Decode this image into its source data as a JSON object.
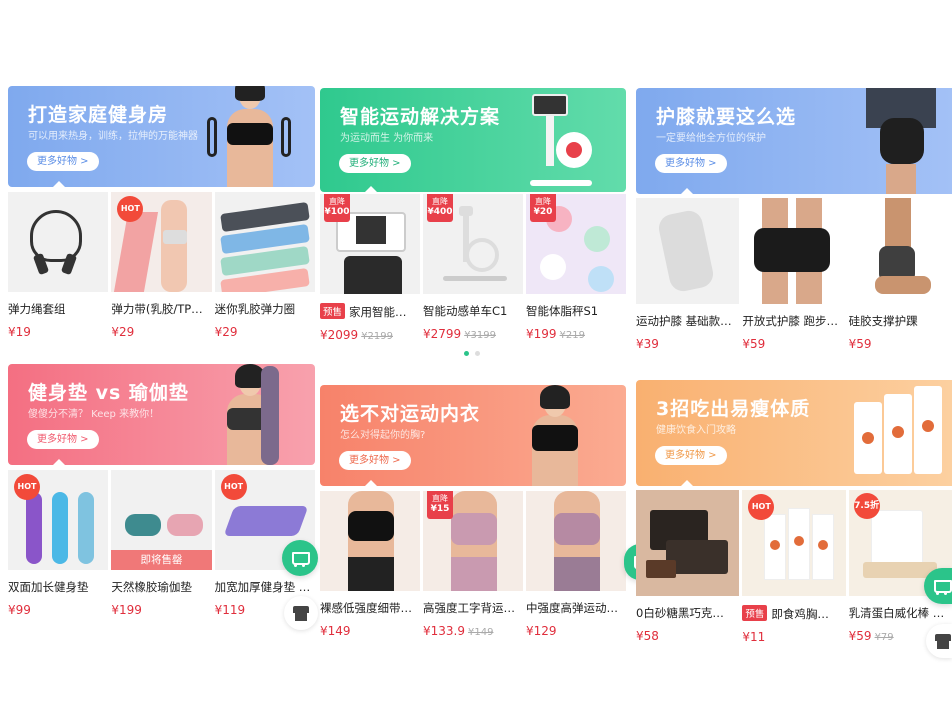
{
  "panels": [
    {
      "id": "home-gym",
      "banner": {
        "title": "打造家庭健身房",
        "subtitle": "可以用来热身，训练，拉伸的万能神器",
        "more": "更多好物 >",
        "bg1": "#7fa9ee",
        "bg2": "#9dbdf5",
        "more_color": "#5b8ee6"
      },
      "products": [
        {
          "name": "弹力绳套组",
          "price": "¥19",
          "badge": ""
        },
        {
          "name": "弹力带(乳胶/TP…",
          "price": "¥29",
          "badge": "HOT"
        },
        {
          "name": "迷你乳胶弹力圈",
          "price": "¥29",
          "badge": ""
        }
      ]
    },
    {
      "id": "smart-sport",
      "banner": {
        "title": "智能运动解决方案",
        "subtitle": "为运动而生 为你而来",
        "more": "更多好物 >",
        "bg1": "#2fc98e",
        "bg2": "#5ad9a7",
        "more_color": "#22b07a"
      },
      "products": [
        {
          "name": "家用智能…",
          "price": "¥2099",
          "orig": "¥2199",
          "pretag": "预售",
          "zhijiang": "¥100"
        },
        {
          "name": "智能动感单车C1",
          "price": "¥2799",
          "orig": "¥3199",
          "zhijiang": "¥400"
        },
        {
          "name": "智能体脂秤S1",
          "price": "¥199",
          "orig": "¥219",
          "zhijiang": "¥20"
        }
      ]
    },
    {
      "id": "knee",
      "banner": {
        "title": "护膝就要这么选",
        "subtitle": "一定要给他全方位的保护",
        "more": "更多好物 >",
        "bg1": "#7fa9ee",
        "bg2": "#9dbdf5",
        "more_color": "#5b8ee6"
      },
      "products": [
        {
          "name": "运动护膝 基础款…",
          "price": "¥39"
        },
        {
          "name": "开放式护膝 跑步…",
          "price": "¥59"
        },
        {
          "name": "硅胶支撑护踝",
          "price": "¥59"
        }
      ]
    },
    {
      "id": "mat",
      "banner": {
        "title": "健身垫 vs 瑜伽垫",
        "subtitle": "傻傻分不清？ Keep 来教你！",
        "more": "更多好物 >",
        "bg1": "#f46f82",
        "bg2": "#f993a0",
        "more_color": "#f05a6e"
      },
      "products": [
        {
          "name": "双面加长健身垫",
          "price": "¥99",
          "badge": "HOT"
        },
        {
          "name": "天然橡胶瑜伽垫",
          "price": "¥199",
          "soldout": "即将售罄"
        },
        {
          "name": "加宽加厚健身垫 …",
          "price": "¥119",
          "badge": "HOT"
        }
      ]
    },
    {
      "id": "bra",
      "banner": {
        "title": "选不对运动内衣",
        "subtitle": "怎么对得起你的胸?",
        "more": "更多好物 >",
        "bg1": "#f7826a",
        "bg2": "#f99f85",
        "more_color": "#ee6a4e"
      },
      "products": [
        {
          "name": "裸感低强度细带…",
          "price": "¥149"
        },
        {
          "name": "高强度工字背运…",
          "price": "¥133.9",
          "orig": "¥149",
          "zhijiang": "¥15"
        },
        {
          "name": "中强度高弹运动…",
          "price": "¥129"
        }
      ]
    },
    {
      "id": "diet",
      "banner": {
        "title": "3招吃出易瘦体质",
        "subtitle": "健康饮食入门攻略",
        "more": "更多好物 >",
        "bg1": "#f9b070",
        "bg2": "#fbc48a",
        "more_color": "#f09a4a"
      },
      "products": [
        {
          "name": "0白砂糖黑巧克…",
          "price": "¥58"
        },
        {
          "name": "即食鸡胸…",
          "price": "¥11",
          "pretag": "预售",
          "badge": "HOT"
        },
        {
          "name": "乳清蛋白威化棒 …",
          "price": "¥59",
          "orig": "¥79",
          "discount": "7.5折"
        }
      ]
    }
  ],
  "labels": {
    "zhijiang": "直降",
    "keep": "Keep"
  }
}
